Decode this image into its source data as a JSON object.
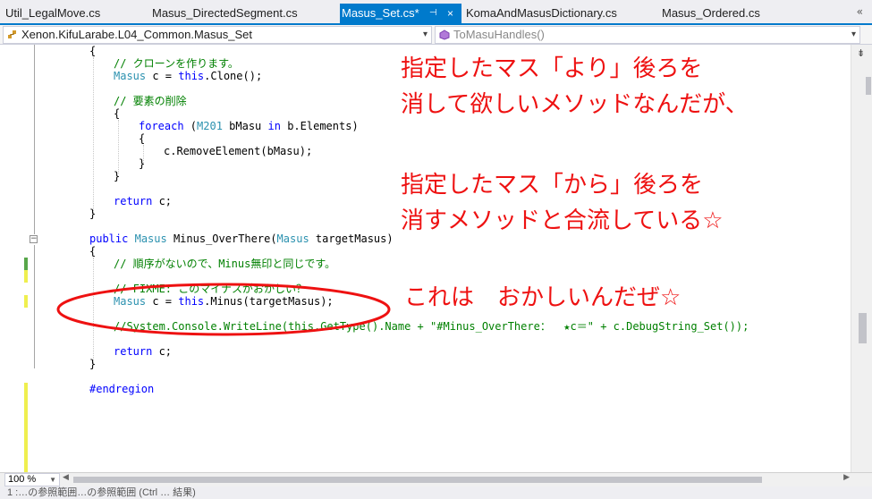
{
  "tabs": [
    {
      "label": "Util_LegalMove.cs"
    },
    {
      "label": "Masus_DirectedSegment.cs"
    },
    {
      "label": "Masus_Set.cs*",
      "active": true,
      "pin": "⊣",
      "close": "×"
    },
    {
      "label": "KomaAndMasusDictionary.cs"
    },
    {
      "label": "Masus_Ordered.cs"
    }
  ],
  "tab_overflow": "«",
  "navbar": {
    "class_dropdown": "Xenon.KifuLarabe.L04_Common.Masus_Set",
    "member_dropdown": "ToMasuHandles()",
    "class_icon": "class-icon",
    "member_icon": "method-icon"
  },
  "code_lines": {
    "l1": "{",
    "l2": "// クローンを作ります。",
    "l3a": "Masus",
    "l3b": " c = ",
    "l3c": "this",
    "l3d": ".Clone();",
    "l5": "// 要素の削除",
    "l6": "{",
    "l7a": "foreach",
    "l7b": " (",
    "l7c": "M201",
    "l7d": " bMasu ",
    "l7e": "in",
    "l7f": " b.Elements)",
    "l8": "{",
    "l9": "c.RemoveElement(bMasu);",
    "l10": "}",
    "l11": "}",
    "l13a": "return",
    "l13b": " c;",
    "l14": "}",
    "l16a": "public",
    "l16b": " ",
    "l16c": "Masus",
    "l16d": " Minus_OverThere(",
    "l16e": "Masus",
    "l16f": " targetMasus)",
    "l17": "{",
    "l18": "// 順序がないので、Minus無印と同じです。",
    "l20": "// FIXME: このマイナスがおかしい？",
    "l21a": "Masus",
    "l21b": " c = ",
    "l21c": "this",
    "l21d": ".Minus(targetMasus);",
    "l23a": "//System.Console.WriteLine(this.GetType().Name + ",
    "l23b": "\"#Minus_OverThere：  ★c＝\"",
    "l23c": " + c.DebugString_Set());",
    "l25a": "return",
    "l25b": " c;",
    "l26": "}",
    "l28": "#endregion"
  },
  "annotations": {
    "a1": "指定したマス「より」後ろを",
    "a2": "消して欲しいメソッドなんだが、",
    "a3": "指定したマス「から」後ろを",
    "a4": "消すメソッドと合流している☆",
    "a5": "これは　おかしいんだぜ☆"
  },
  "zoom": "100 %",
  "status": "1 :…の参照範囲…の参照範囲 (Ctrl … 結果)",
  "colors": {
    "accent": "#007acc",
    "annotation": "#ee1111",
    "comment": "#008000",
    "keyword": "#0000ff",
    "type": "#2b91af"
  }
}
